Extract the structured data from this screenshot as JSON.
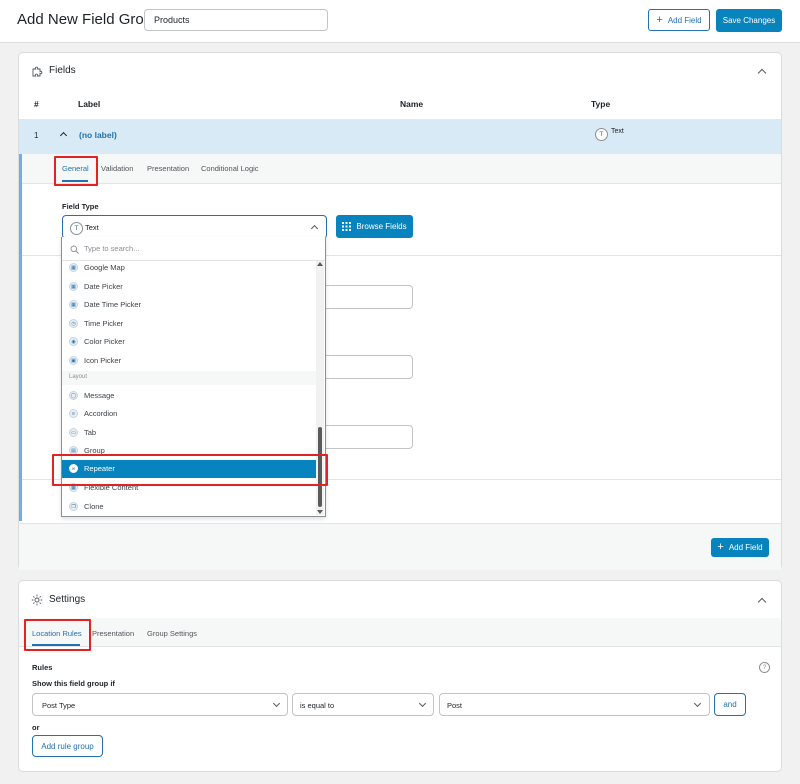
{
  "header": {
    "title": "Add New Field Group",
    "group_name_value": "Products",
    "add_field_label": "Add Field",
    "save_label": "Save Changes"
  },
  "fields_panel": {
    "title": "Fields",
    "columns": {
      "num": "#",
      "label": "Label",
      "name": "Name",
      "type": "Type"
    },
    "row": {
      "num": "1",
      "label": "(no label)",
      "type_icon": "T",
      "type": "Text"
    },
    "tabs": [
      "General",
      "Validation",
      "Presentation",
      "Conditional Logic"
    ],
    "field_type_label": "Field Type",
    "field_type_value": "Text",
    "field_type_icon": "T",
    "browse_fields_label": "Browse Fields",
    "search_placeholder": "Type to search...",
    "dropdown_items_before": [
      {
        "label": "Google Map",
        "icon": "map-icon"
      },
      {
        "label": "Date Picker",
        "icon": "calendar-icon"
      },
      {
        "label": "Date Time Picker",
        "icon": "calendar-clock-icon"
      },
      {
        "label": "Time Picker",
        "icon": "clock-icon"
      },
      {
        "label": "Color Picker",
        "icon": "palette-icon"
      },
      {
        "label": "Icon Picker",
        "icon": "icon-picker-icon"
      }
    ],
    "dropdown_group": "Layout",
    "dropdown_items_after": [
      {
        "label": "Message",
        "icon": "message-icon"
      },
      {
        "label": "Accordion",
        "icon": "accordion-icon"
      },
      {
        "label": "Tab",
        "icon": "tab-icon"
      },
      {
        "label": "Group",
        "icon": "group-icon"
      },
      {
        "label": "Repeater",
        "icon": "repeater-icon",
        "selected": true
      },
      {
        "label": "Flexible Content",
        "icon": "flexible-content-icon"
      },
      {
        "label": "Clone",
        "icon": "clone-icon"
      }
    ],
    "add_field_label": "Add Field"
  },
  "settings_panel": {
    "title": "Settings",
    "tabs": [
      "Location Rules",
      "Presentation",
      "Group Settings"
    ],
    "rules_label": "Rules",
    "show_if_label": "Show this field group if",
    "rule": {
      "param": "Post Type",
      "operator": "is equal to",
      "value": "Post"
    },
    "and_label": "and",
    "or_label": "or",
    "add_rule_group_label": "Add rule group"
  },
  "colors": {
    "accent": "#2271b1",
    "primary_button": "#0783be",
    "highlight_row": "#d8eaf6",
    "annotation_red": "#e12323"
  }
}
